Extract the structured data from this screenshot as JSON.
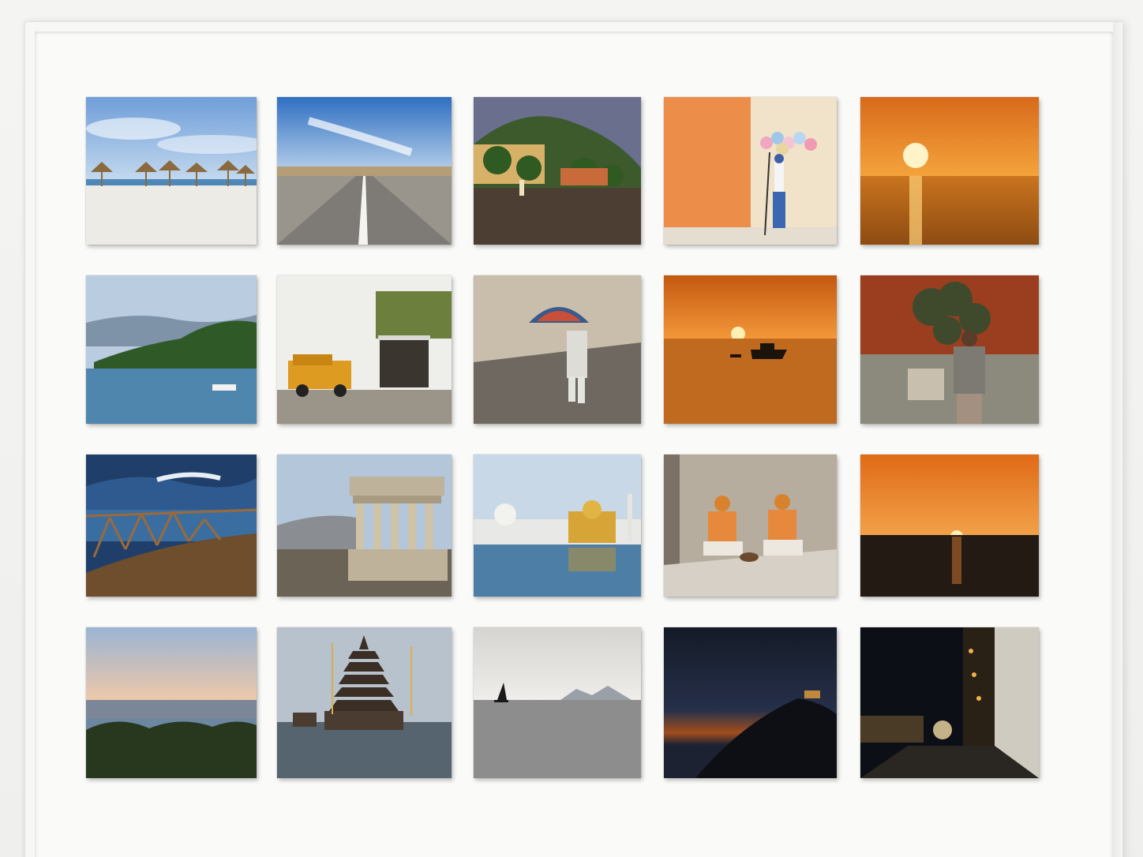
{
  "gallery": {
    "rows": 4,
    "columns": 5,
    "photos": [
      {
        "subject": "beach-umbrellas"
      },
      {
        "subject": "open-road"
      },
      {
        "subject": "palm-street"
      },
      {
        "subject": "balloon-seller"
      },
      {
        "subject": "ocean-sunset"
      },
      {
        "subject": "island-bay"
      },
      {
        "subject": "yellow-jeep"
      },
      {
        "subject": "umbrella-walker"
      },
      {
        "subject": "boat-sunset"
      },
      {
        "subject": "garden-woman"
      },
      {
        "subject": "ocean-waves"
      },
      {
        "subject": "ancient-temple"
      },
      {
        "subject": "golden-temple"
      },
      {
        "subject": "street-musicians"
      },
      {
        "subject": "horizon-sunset"
      },
      {
        "subject": "harbor-dusk"
      },
      {
        "subject": "pagoda-lake"
      },
      {
        "subject": "sailboat-sea"
      },
      {
        "subject": "night-hill"
      },
      {
        "subject": "night-alley"
      }
    ]
  },
  "colors": {
    "wall": "#f4f4f2",
    "frame": "#f7f7f5",
    "sunset": "#e8842a"
  }
}
